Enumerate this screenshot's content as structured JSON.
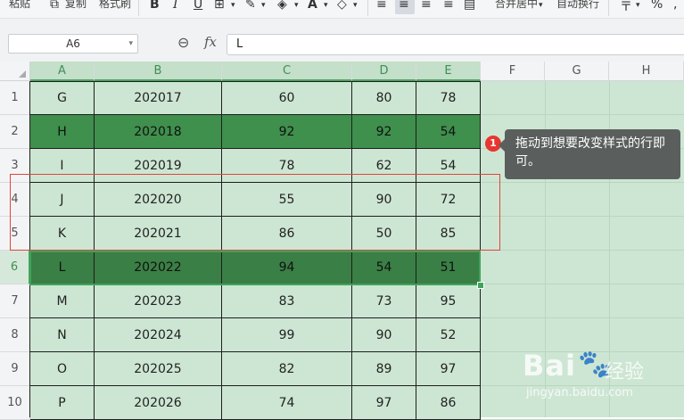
{
  "ribbon": {
    "paste": "粘贴",
    "copy": "复制",
    "format_painter": "格式刷",
    "merge_center": "合并居中",
    "auto_wrap": "自动换行",
    "bold_icon": "bold-icon",
    "italic_icon": "italic-icon",
    "underline_icon": "underline-icon"
  },
  "formula_bar": {
    "name_box": "A6",
    "fx": "fx",
    "formula_value": "L"
  },
  "columns": [
    "A",
    "B",
    "C",
    "D",
    "E",
    "F",
    "G",
    "H"
  ],
  "selected_row": "6",
  "rows": [
    {
      "num": "1",
      "cells": [
        "G",
        "202017",
        "60",
        "80",
        "78"
      ]
    },
    {
      "num": "2",
      "cells": [
        "H",
        "202018",
        "92",
        "92",
        "54"
      ]
    },
    {
      "num": "3",
      "cells": [
        "I",
        "202019",
        "78",
        "62",
        "54"
      ]
    },
    {
      "num": "4",
      "cells": [
        "J",
        "202020",
        "55",
        "90",
        "72"
      ]
    },
    {
      "num": "5",
      "cells": [
        "K",
        "202021",
        "86",
        "50",
        "85"
      ]
    },
    {
      "num": "6",
      "cells": [
        "L",
        "202022",
        "94",
        "54",
        "51"
      ]
    },
    {
      "num": "7",
      "cells": [
        "M",
        "202023",
        "83",
        "73",
        "95"
      ]
    },
    {
      "num": "8",
      "cells": [
        "N",
        "202024",
        "99",
        "90",
        "52"
      ]
    },
    {
      "num": "9",
      "cells": [
        "O",
        "202025",
        "82",
        "89",
        "97"
      ]
    },
    {
      "num": "10",
      "cells": [
        "P",
        "202026",
        "74",
        "97",
        "86"
      ]
    }
  ],
  "callout": {
    "step": "1",
    "text": "拖动到想要改变样式的行即可。"
  },
  "watermark": {
    "logo": "Bai",
    "brand": "经验",
    "url": "jingyan.baidu.com"
  },
  "colors": {
    "cell_bg": "#cde6d3",
    "highlight_row": "#3f8f4d",
    "selected_row": "#3a7f45",
    "selection_border": "#3fa35a",
    "annotation_red": "#e0453b"
  }
}
